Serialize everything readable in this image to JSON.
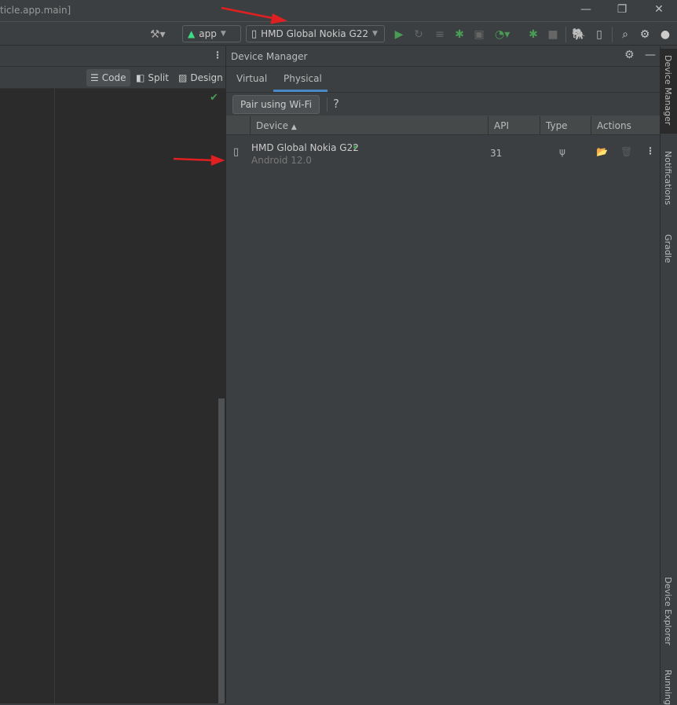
{
  "window": {
    "title": "ticle.app.main]",
    "minimize": "—",
    "restore": "❐",
    "close": "✕"
  },
  "toolbar": {
    "config": "app",
    "device": "HMD Global Nokia G22"
  },
  "editor": {
    "modes": [
      {
        "label": "Code",
        "selected": true
      },
      {
        "label": "Split"
      },
      {
        "label": "Design"
      }
    ]
  },
  "device_manager": {
    "title": "Device Manager",
    "tabs": [
      {
        "label": "Virtual"
      },
      {
        "label": "Physical",
        "selected": true
      }
    ],
    "pair_button": "Pair using Wi-Fi",
    "help": "?",
    "columns": [
      "Device",
      "API",
      "Type",
      "Actions"
    ],
    "rows": [
      {
        "name": "HMD Global Nokia G22",
        "os": "Android 12.0",
        "api": "31",
        "type": "usb-icon",
        "online": true
      }
    ]
  },
  "side_tools": [
    "Device Manager",
    "Notifications",
    "Gradle",
    "Device Explorer",
    "Running"
  ],
  "colors": {
    "accent": "#4a88c7",
    "green": "#499c54",
    "annotation": "#e02020"
  }
}
